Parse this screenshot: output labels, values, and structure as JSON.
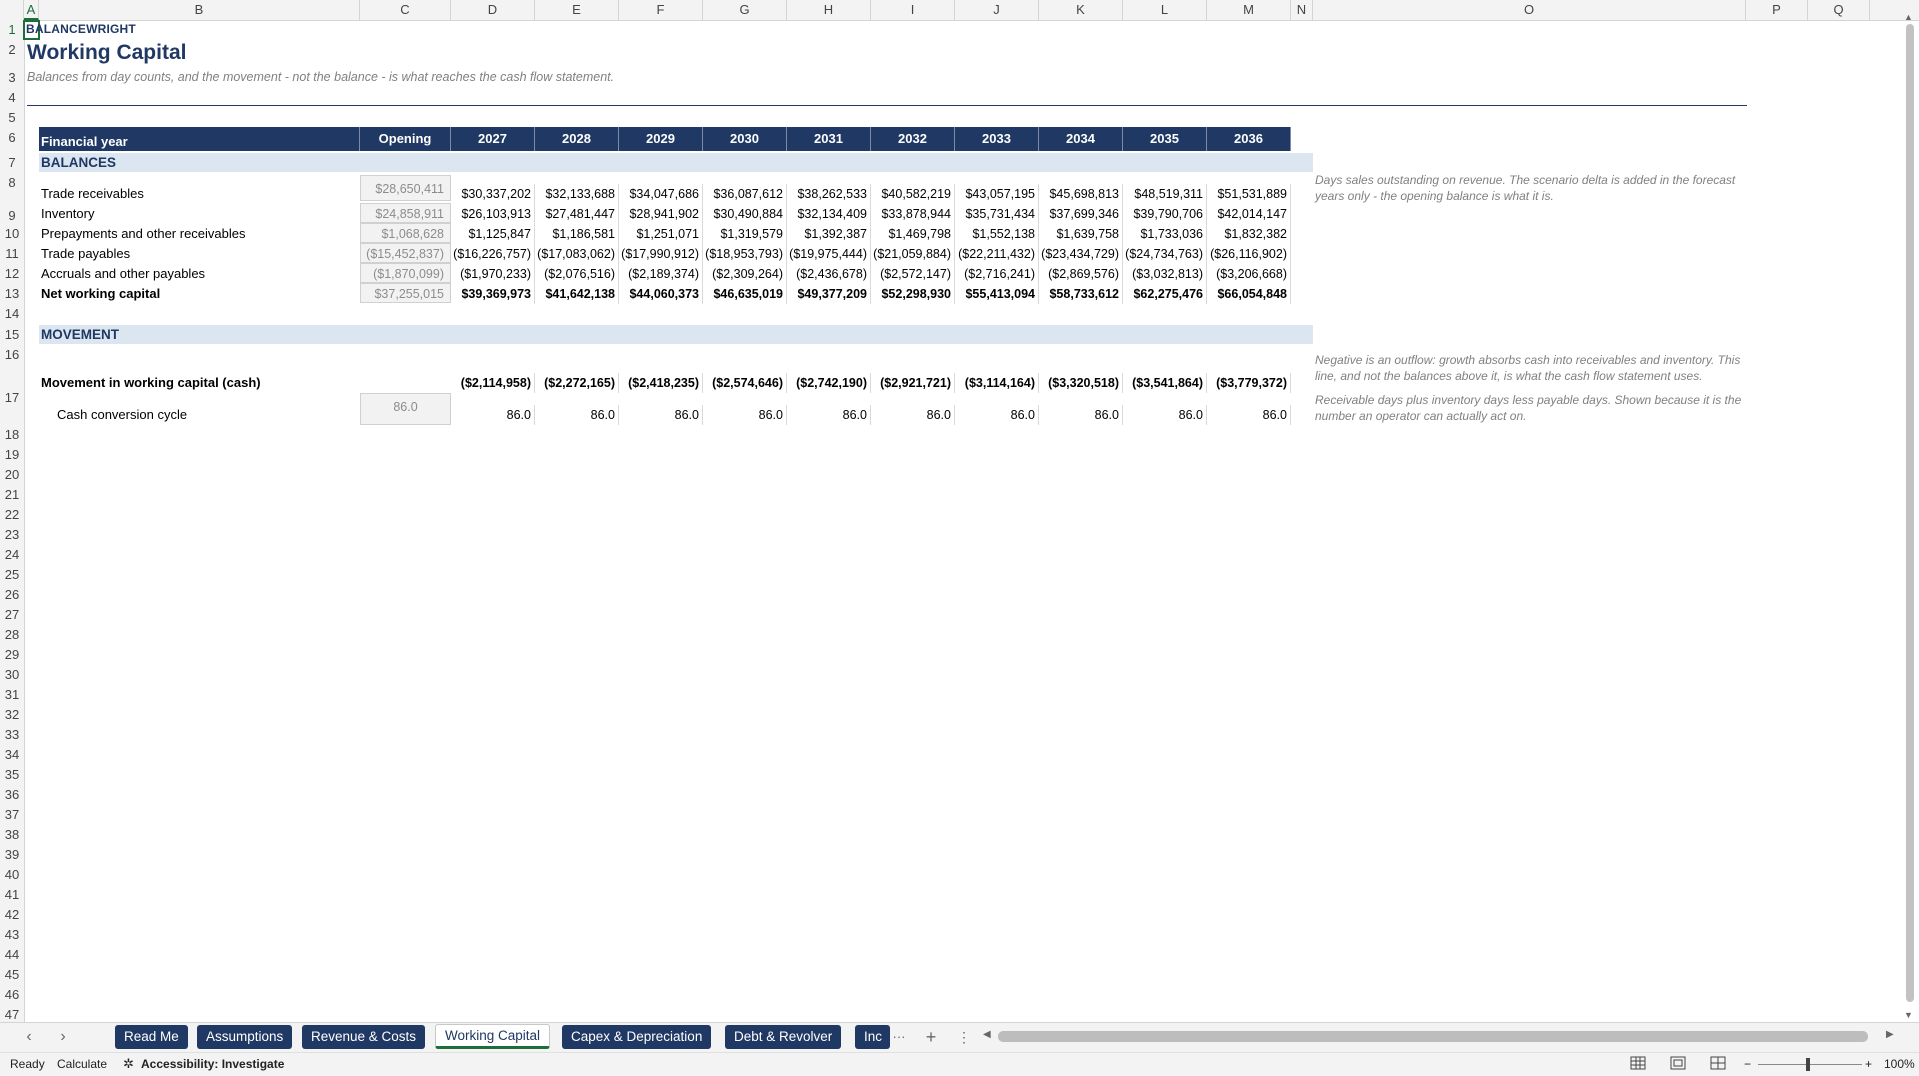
{
  "columns": [
    "A",
    "B",
    "C",
    "D",
    "E",
    "F",
    "G",
    "H",
    "I",
    "J",
    "K",
    "L",
    "M",
    "N",
    "O",
    "P",
    "Q"
  ],
  "rows": [
    "1",
    "2",
    "3",
    "4",
    "5",
    "6",
    "7",
    "8",
    "9",
    "10",
    "11",
    "12",
    "13",
    "14",
    "15",
    "16",
    "17",
    "18",
    "19",
    "20",
    "21",
    "22",
    "23",
    "24",
    "25",
    "26",
    "27",
    "28",
    "29",
    "30",
    "31",
    "32",
    "33",
    "34",
    "35",
    "36",
    "37",
    "38",
    "39",
    "40",
    "41",
    "42",
    "43",
    "44",
    "45",
    "46",
    "47"
  ],
  "sheet": {
    "brand": "BALANCEWRIGHT",
    "title": "Working Capital",
    "subtitle": "Balances from day counts, and the movement - not the balance - is what reaches the cash flow statement."
  },
  "table": {
    "header_label": "Financial year",
    "opening_label": "Opening",
    "years": [
      "2027",
      "2028",
      "2029",
      "2030",
      "2031",
      "2032",
      "2033",
      "2034",
      "2035",
      "2036"
    ],
    "balances_title": "BALANCES",
    "movement_title": "MOVEMENT",
    "balance_rows": [
      {
        "label": "Trade receivables",
        "opening": "$28,650,411",
        "values": [
          "$30,337,202",
          "$32,133,688",
          "$34,047,686",
          "$36,087,612",
          "$38,262,533",
          "$40,582,219",
          "$43,057,195",
          "$45,698,813",
          "$48,519,311",
          "$51,531,889"
        ]
      },
      {
        "label": "Inventory",
        "opening": "$24,858,911",
        "values": [
          "$26,103,913",
          "$27,481,447",
          "$28,941,902",
          "$30,490,884",
          "$32,134,409",
          "$33,878,944",
          "$35,731,434",
          "$37,699,346",
          "$39,790,706",
          "$42,014,147"
        ]
      },
      {
        "label": "Prepayments and other receivables",
        "opening": "$1,068,628",
        "values": [
          "$1,125,847",
          "$1,186,581",
          "$1,251,071",
          "$1,319,579",
          "$1,392,387",
          "$1,469,798",
          "$1,552,138",
          "$1,639,758",
          "$1,733,036",
          "$1,832,382"
        ]
      },
      {
        "label": "Trade payables",
        "opening": "($15,452,837)",
        "values": [
          "($16,226,757)",
          "($17,083,062)",
          "($17,990,912)",
          "($18,953,793)",
          "($19,975,444)",
          "($21,059,884)",
          "($22,211,432)",
          "($23,434,729)",
          "($24,734,763)",
          "($26,116,902)"
        ]
      },
      {
        "label": "Accruals and other payables",
        "opening": "($1,870,099)",
        "values": [
          "($1,970,233)",
          "($2,076,516)",
          "($2,189,374)",
          "($2,309,264)",
          "($2,436,678)",
          "($2,572,147)",
          "($2,716,241)",
          "($2,869,576)",
          "($3,032,813)",
          "($3,206,668)"
        ]
      },
      {
        "label": "Net working capital",
        "opening": "$37,255,015",
        "values": [
          "$39,369,973",
          "$41,642,138",
          "$44,060,373",
          "$46,635,019",
          "$49,377,209",
          "$52,298,930",
          "$55,413,094",
          "$58,733,612",
          "$62,275,476",
          "$66,054,848"
        ]
      }
    ],
    "movement_row": {
      "label": "Movement in working capital (cash)",
      "values": [
        "($2,114,958)",
        "($2,272,165)",
        "($2,418,235)",
        "($2,574,646)",
        "($2,742,190)",
        "($2,921,721)",
        "($3,114,164)",
        "($3,320,518)",
        "($3,541,864)",
        "($3,779,372)"
      ]
    },
    "ccc_row": {
      "label": "Cash conversion cycle",
      "opening": "86.0",
      "values": [
        "86.0",
        "86.0",
        "86.0",
        "86.0",
        "86.0",
        "86.0",
        "86.0",
        "86.0",
        "86.0",
        "86.0"
      ]
    }
  },
  "notes": {
    "receivables": "Days sales outstanding on revenue. The scenario delta is added in the forecast years only - the opening balance is what it is.",
    "movement": "Negative is an outflow: growth absorbs cash into receivables and inventory. This line, and not the balances above it, is what the cash flow statement uses.",
    "ccc": "Receivable days plus inventory days less payable days. Shown because it is the number an operator can actually act on."
  },
  "tabs": [
    "Read Me",
    "Assumptions",
    "Revenue & Costs",
    "Working Capital",
    "Capex & Depreciation",
    "Debt & Revolver",
    "Inc"
  ],
  "active_tab": "Working Capital",
  "tab_controls": {
    "more": "···",
    "add": "+",
    "options": "⋮",
    "prev": "‹",
    "next": "›"
  },
  "status": {
    "ready": "Ready",
    "calculate": "Calculate",
    "accessibility": "Accessibility: Investigate",
    "zoom": "100%",
    "zoom_minus": "−",
    "zoom_plus": "+"
  }
}
